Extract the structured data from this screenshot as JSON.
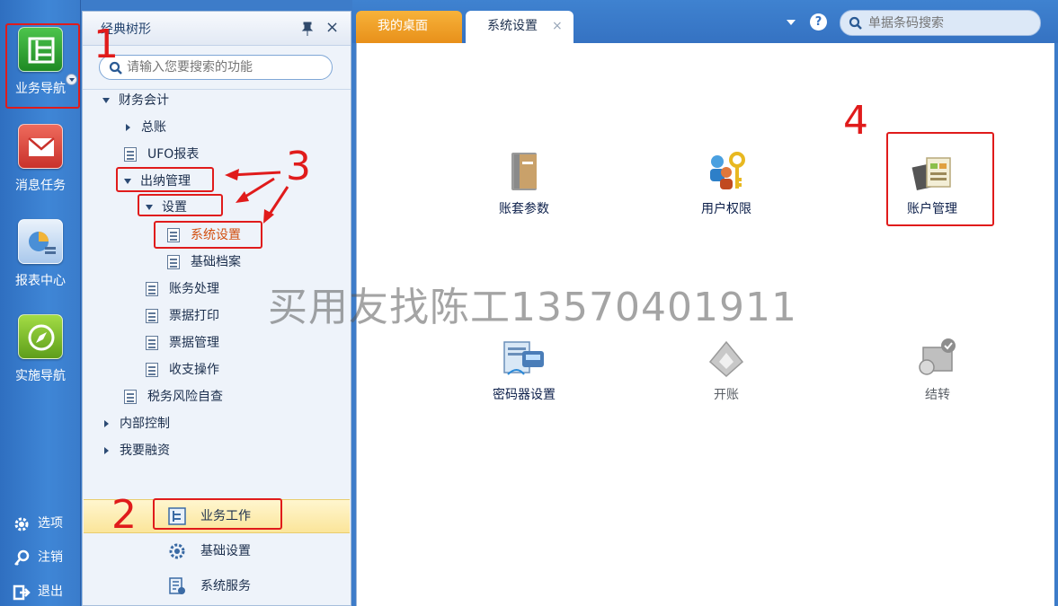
{
  "rail": {
    "items": [
      {
        "label": "业务导航",
        "icon": "business-nav-icon",
        "color": "#2fa32f"
      },
      {
        "label": "消息任务",
        "icon": "message-icon",
        "color": "#d9443a"
      },
      {
        "label": "报表中心",
        "icon": "report-icon",
        "color": "#4a8fd6"
      },
      {
        "label": "实施导航",
        "icon": "compass-icon",
        "color": "#7bbf2c"
      }
    ],
    "bottom": [
      {
        "label": "选项",
        "icon": "gear-icon"
      },
      {
        "label": "注销",
        "icon": "key-icon"
      },
      {
        "label": "退出",
        "icon": "exit-icon"
      }
    ]
  },
  "tree": {
    "title": "经典树形",
    "search_placeholder": "请输入您要搜索的功能",
    "nodes": [
      {
        "label": "财务会计",
        "type": "expanded"
      },
      {
        "label": "总账",
        "type": "collapsed"
      },
      {
        "label": "UFO报表",
        "type": "leaf"
      },
      {
        "label": "出纳管理",
        "type": "expanded"
      },
      {
        "label": "设置",
        "type": "expanded"
      },
      {
        "label": "系统设置",
        "type": "leaf",
        "active": true
      },
      {
        "label": "基础档案",
        "type": "leaf"
      },
      {
        "label": "账务处理",
        "type": "leaf"
      },
      {
        "label": "票据打印",
        "type": "leaf"
      },
      {
        "label": "票据管理",
        "type": "leaf"
      },
      {
        "label": "收支操作",
        "type": "leaf"
      },
      {
        "label": "税务风险自查",
        "type": "leaf"
      },
      {
        "label": "内部控制",
        "type": "collapsed"
      },
      {
        "label": "我要融资",
        "type": "collapsed"
      }
    ],
    "modules": [
      {
        "label": "业务工作",
        "icon": "business-work-icon",
        "selected": true
      },
      {
        "label": "基础设置",
        "icon": "gear-icon"
      },
      {
        "label": "系统服务",
        "icon": "system-service-icon"
      }
    ]
  },
  "tabs": [
    {
      "label": "我的桌面"
    },
    {
      "label": "系统设置",
      "close": "×"
    }
  ],
  "toolbar": {
    "help_label": "?",
    "search_placeholder": "单据条码搜索"
  },
  "functions": [
    {
      "label": "账套参数",
      "icon": "book-icon",
      "enabled": true
    },
    {
      "label": "用户权限",
      "icon": "user-key-icon",
      "enabled": true
    },
    {
      "label": "账户管理",
      "icon": "account-manage-icon",
      "enabled": true
    },
    {
      "label": "密码器设置",
      "icon": "password-device-icon",
      "enabled": true
    },
    {
      "label": "开账",
      "icon": "open-account-icon",
      "enabled": false
    },
    {
      "label": "结转",
      "icon": "carry-forward-icon",
      "enabled": false
    }
  ],
  "annotations": {
    "numbers": [
      "1",
      "2",
      "3",
      "4"
    ],
    "color": "#e01b1b"
  },
  "watermark": "买用友找陈工13570401911"
}
